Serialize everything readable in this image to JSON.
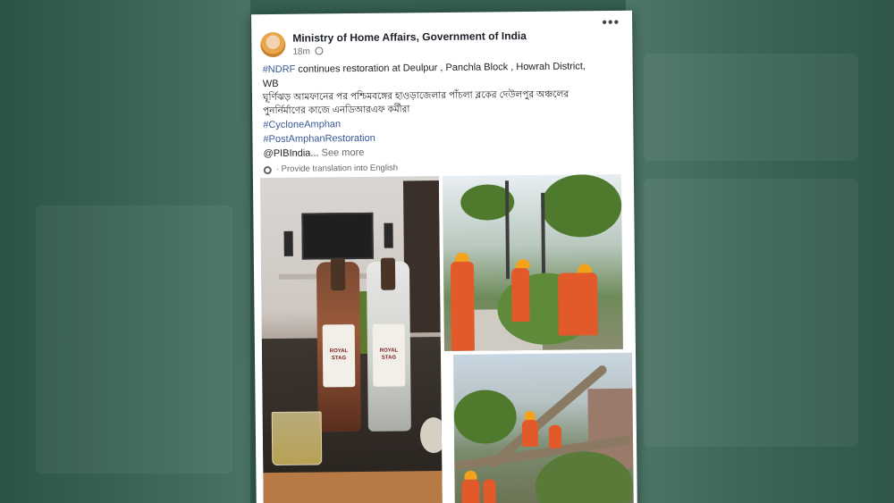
{
  "post": {
    "page_name": "Ministry of Home Affairs, Government of India",
    "time": "18m",
    "lines": [
      {
        "tag": "#NDRF",
        "text": " continues restoration at Deulpur , Panchla Block , Howrah District,"
      },
      {
        "tag": "",
        "text": "WB"
      }
    ],
    "bengali_lines": [
      "ঘূর্ণিঝড় আমফানের পর পশ্চিমবঙ্গের হাওড়াজেলার পাঁচলা ব্লকের দেউলপুর অঞ্চলের",
      "পুনর্নির্মাণের কাজে এনডিআরএফ কর্মীরা"
    ],
    "hashtags": [
      "#CycloneAmphan",
      "#PostAmphanRestoration"
    ],
    "mention": "@PIBIndia...",
    "see_more": "See more",
    "translate_label": "· Provide translation into English",
    "more_label": "•••",
    "bottle_label": "ROYAL STAG"
  },
  "icons": {
    "more": "more-options-icon",
    "globe": "globe-icon",
    "translate": "gear-icon"
  },
  "colors": {
    "background": "#355f52",
    "link": "#385898",
    "text": "#1c1e21",
    "secondary": "#65676b"
  }
}
